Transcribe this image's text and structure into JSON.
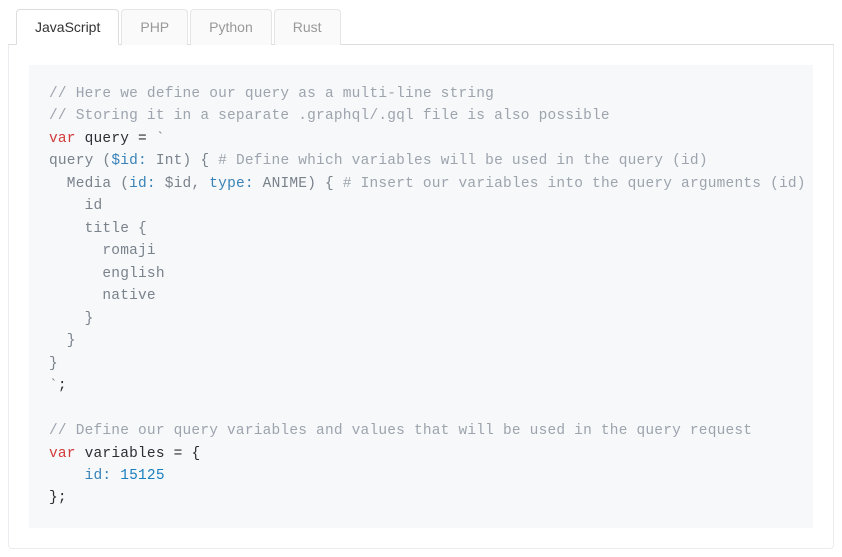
{
  "tabs": {
    "items": [
      {
        "label": "JavaScript",
        "active": true
      },
      {
        "label": "PHP",
        "active": false
      },
      {
        "label": "Python",
        "active": false
      },
      {
        "label": "Rust",
        "active": false
      }
    ]
  },
  "code": {
    "c1": "// Here we define our query as a multi-line string",
    "c2": "// Storing it in a separate .graphql/.gql file is also possible",
    "kw_var1": "var",
    "ident_query": " query ",
    "eq1": "= ",
    "backtick_open": "`",
    "line_q1a": "query (",
    "line_q1_id": "$id:",
    "line_q1b": " Int) { ",
    "line_q1_comment": "# Define which variables will be used in the query (id)",
    "line_q2a": "  Media (",
    "line_q2_id": "id:",
    "line_q2b": " $id, ",
    "line_q2_type": "type:",
    "line_q2c": " ANIME) { ",
    "line_q2_comment": "# Insert our variables into the query arguments (id) (type",
    "line_q3": "    id",
    "line_q4": "    title {",
    "line_q5": "      romaji",
    "line_q6": "      english",
    "line_q7": "      native",
    "line_q8": "    }",
    "line_q9": "  }",
    "line_q10": "}",
    "backtick_close": "`",
    "semi1": ";",
    "blank": "",
    "c3": "// Define our query variables and values that will be used in the query request",
    "kw_var2": "var",
    "ident_vars": " variables ",
    "eq2": "= {",
    "obj_key": "id:",
    "obj_val": " 15125",
    "obj_close": "};",
    "indent4": "    "
  },
  "chart_data": null
}
